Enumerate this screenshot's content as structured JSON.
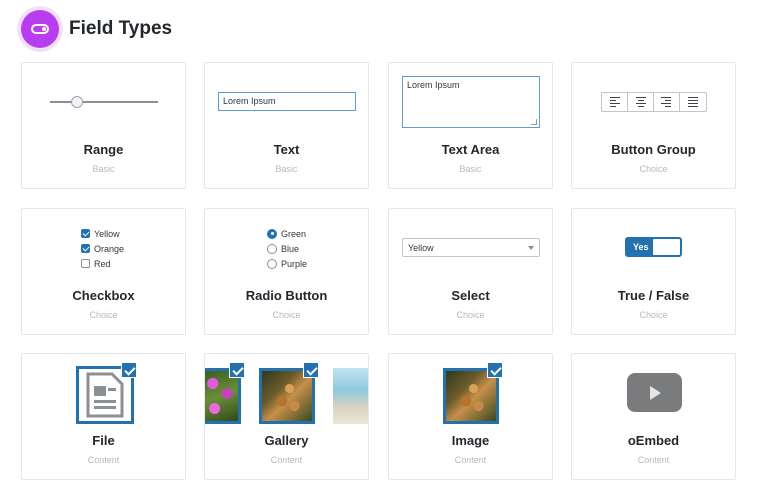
{
  "header": {
    "title": "Field Types",
    "icon": "toggle-icon",
    "icon_color": "#b83cf0"
  },
  "cards": [
    {
      "title": "Range",
      "category": "Basic"
    },
    {
      "title": "Text",
      "category": "Basic"
    },
    {
      "title": "Text Area",
      "category": "Basic"
    },
    {
      "title": "Button Group",
      "category": "Choice"
    },
    {
      "title": "Checkbox",
      "category": "Choice"
    },
    {
      "title": "Radio Button",
      "category": "Choice"
    },
    {
      "title": "Select",
      "category": "Choice"
    },
    {
      "title": "True / False",
      "category": "Choice"
    },
    {
      "title": "File",
      "category": "Content"
    },
    {
      "title": "Gallery",
      "category": "Content"
    },
    {
      "title": "Image",
      "category": "Content"
    },
    {
      "title": "oEmbed",
      "category": "Content"
    }
  ],
  "previews": {
    "range": {
      "value_fraction": 0.25
    },
    "text": {
      "value": "Lorem Ipsum"
    },
    "textarea": {
      "value": "Lorem Ipsum"
    },
    "button_group": {
      "icons": [
        "align-left-icon",
        "align-center-icon",
        "align-right-icon",
        "align-justify-icon"
      ]
    },
    "checkbox": {
      "options": [
        {
          "label": "Yellow",
          "checked": true
        },
        {
          "label": "Orange",
          "checked": true
        },
        {
          "label": "Red",
          "checked": false
        }
      ]
    },
    "radio": {
      "options": [
        {
          "label": "Green",
          "checked": true
        },
        {
          "label": "Blue",
          "checked": false
        },
        {
          "label": "Purple",
          "checked": false
        }
      ]
    },
    "select": {
      "value": "Yellow"
    },
    "true_false": {
      "label": "Yes",
      "on": true
    },
    "file": {
      "icon": "document-icon"
    },
    "oembed": {
      "icon": "play-icon"
    }
  },
  "colors": {
    "accent": "#2271b1",
    "card_border": "#e5e7eb",
    "subtitle": "#b4b9be"
  }
}
